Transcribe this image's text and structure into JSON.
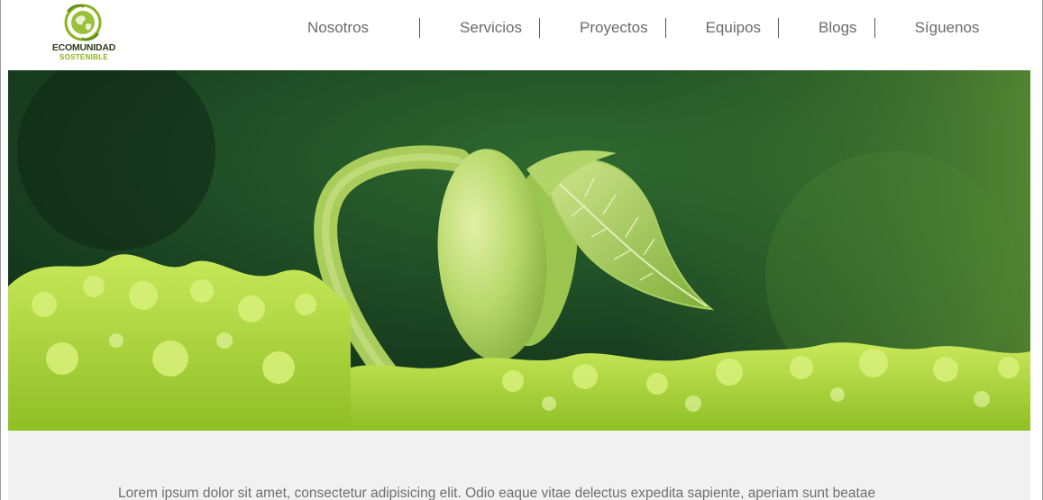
{
  "brand": {
    "name": "ECOMUNIDAD",
    "tagline": "SOSTENIBLE",
    "colors": {
      "dark": "#2f3d1c",
      "green": "#8ab21e"
    },
    "icon": "globe-leaf-logo"
  },
  "nav": {
    "items": [
      {
        "label": "Nosotros"
      },
      {
        "label": "Servicios"
      },
      {
        "label": "Proyectos"
      },
      {
        "label": "Equipos"
      },
      {
        "label": "Blogs"
      },
      {
        "label": "Síguenos"
      }
    ]
  },
  "hero": {
    "image": "sprouting-seedling-photo",
    "colors": {
      "background": "#1e4a22",
      "moss": "#a8d43a",
      "sprout": "#b9d96a"
    }
  },
  "content": {
    "intro_text": "Lorem ipsum dolor sit amet, consectetur adipisicing elit. Odio eaque vitae delectus expedita sapiente, aperiam sunt beatae",
    "background": "#f1f1f1"
  }
}
